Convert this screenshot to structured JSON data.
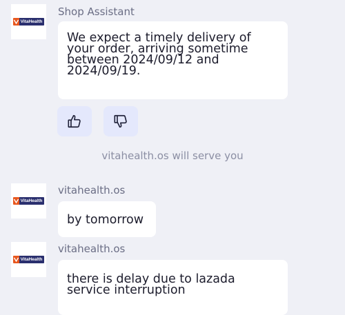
{
  "messages": [
    {
      "sender": "Shop Assistant",
      "avatar_logo": "VitaHealth",
      "text_lines": [
        "We expect a timely delivery of",
        "your order, arriving sometime",
        "between 2024/09/12 and",
        "2024/09/19."
      ]
    },
    {
      "sender": "vitahealth.os",
      "avatar_logo": "VitaHealth",
      "text_lines": [
        "by tomorrow"
      ]
    },
    {
      "sender": "vitahealth.os",
      "avatar_logo": "VitaHealth",
      "text_lines": [
        "there is delay due to lazada",
        "service interruption"
      ]
    }
  ],
  "feedback": {
    "thumbs_up_icon": "thumbs-up-icon",
    "thumbs_down_icon": "thumbs-down-icon"
  },
  "system_note": "vitahealth.os will serve you",
  "colors": {
    "background": "#eff0f6",
    "bubble": "#ffffff",
    "feedback_button": "#e4e8fc",
    "logo_orange": "#e8571e",
    "logo_navy": "#2a2f6e"
  }
}
